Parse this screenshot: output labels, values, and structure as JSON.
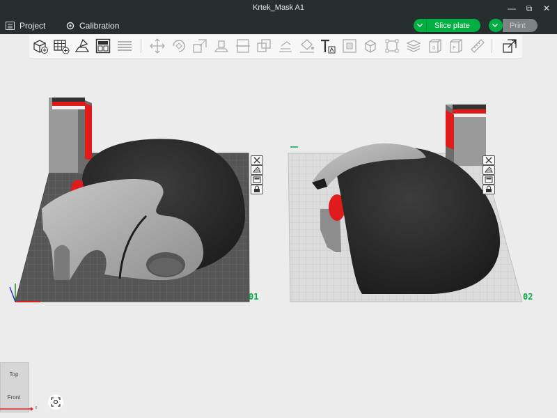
{
  "window": {
    "title": "Krtek_Mask A1",
    "minimize": "—",
    "restore": "⧉",
    "close": "✕"
  },
  "menu": {
    "project_label": "Project",
    "calibration_label": "Calibration"
  },
  "actions": {
    "slice_label": "Slice plate",
    "print_label": "Print"
  },
  "plates": [
    {
      "number": "01"
    },
    {
      "number": "02"
    }
  ],
  "navcube": {
    "top_label": "Top",
    "front_label": "Front",
    "axis_label": "x"
  },
  "colors": {
    "accent": "#00ae42",
    "titlebar": "#262e30",
    "model_dark": "#2b2b2b",
    "model_light": "#a9a9a9",
    "model_red": "#e01b1b"
  },
  "toolbar_icons": [
    "add-object-icon",
    "add-plate-icon",
    "auto-orient-icon",
    "arrange-icon",
    "layers-icon",
    "move-icon",
    "rotate-icon",
    "scale-icon",
    "lay-on-face-icon",
    "cut-icon",
    "boolean-icon",
    "support-paint-icon",
    "color-paint-icon",
    "text-icon",
    "emboss-icon",
    "split-objects-icon",
    "split-parts-icon",
    "variable-height-icon",
    "assembly-icon",
    "plate-view-icon",
    "seam-icon",
    "measure-icon",
    "export-icon"
  ]
}
